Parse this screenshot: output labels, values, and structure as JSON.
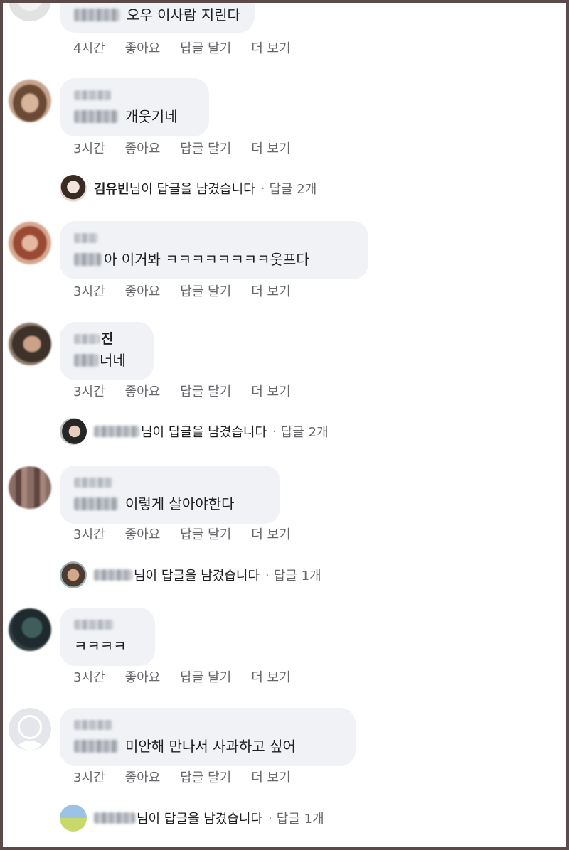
{
  "actions": {
    "like": "좋아요",
    "reply": "답글 달기",
    "more": "더 보기"
  },
  "comments": [
    {
      "text": "오우 이사람 지린다",
      "time": "4시간"
    },
    {
      "text": "개웃기네",
      "time": "3시간"
    },
    {
      "text": "아 이거봐 ㅋㅋㅋㅋㅋㅋㅋㅋ웃프다",
      "time": "3시간"
    },
    {
      "name_suffix": "진",
      "text": "너네",
      "time": "3시간"
    },
    {
      "text": "이렇게 살아야한다",
      "time": "3시간"
    },
    {
      "text": "ㅋㅋㅋㅋ",
      "time": "3시간"
    },
    {
      "text": "미안해 만나서 사과하고 싶어",
      "time": "3시간"
    }
  ],
  "replies": [
    {
      "author": "김유빈",
      "message": "님이 답글을 남겼습니다",
      "separator": "·",
      "count": "답글 2개"
    },
    {
      "message": "님이 답글을 남겼습니다",
      "separator": "·",
      "count": "답글 2개"
    },
    {
      "message": "님이 답글을 남겼습니다",
      "separator": "·",
      "count": "답글 1개"
    },
    {
      "message": "님이 답글을 남겼습니다",
      "separator": "·",
      "count": "답글 1개"
    }
  ],
  "colors": {
    "bubble": "#f0f2f5",
    "meta": "#65676b",
    "frame": "#5a4a4a"
  }
}
